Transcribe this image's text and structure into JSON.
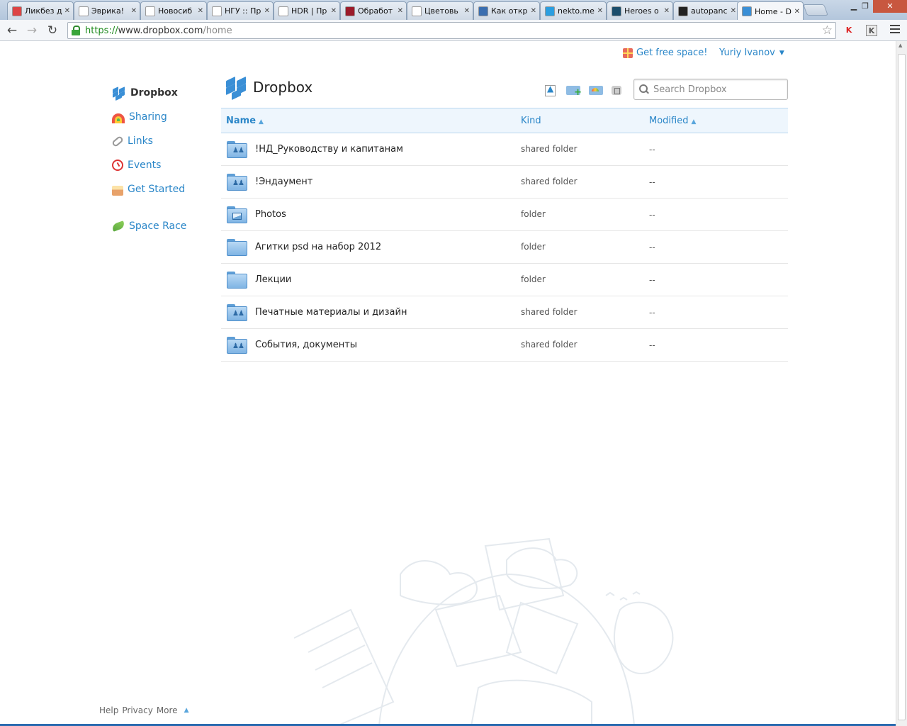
{
  "browser": {
    "tabs": [
      {
        "label": "Ликбез д",
        "icon": "gmail-icon",
        "color": "#d44"
      },
      {
        "label": "Эврика!",
        "icon": "page-icon",
        "color": "#fff"
      },
      {
        "label": "Новосиб",
        "icon": "page-icon",
        "color": "#fff"
      },
      {
        "label": "НГУ :: Пр",
        "icon": "page-icon",
        "color": "#fff"
      },
      {
        "label": "HDR | Пр",
        "icon": "search-icon",
        "color": "#fff"
      },
      {
        "label": "Обработ",
        "icon": "camera-icon",
        "color": "#9b1b2a"
      },
      {
        "label": "Цветовь",
        "icon": "search-icon",
        "color": "#fff"
      },
      {
        "label": "Как откр",
        "icon": "tpp-icon",
        "color": "#3a6eb0"
      },
      {
        "label": "nekto.me",
        "icon": "me-icon",
        "color": "#2a9ee0"
      },
      {
        "label": "Heroes o",
        "icon": "heroes-icon",
        "color": "#1b4d6b"
      },
      {
        "label": "autopanc",
        "icon": "li-icon",
        "color": "#222"
      },
      {
        "label": "Home - D",
        "icon": "dropbox-icon",
        "color": "#3a8fd6"
      }
    ],
    "url_scheme": "https://",
    "url_host": "www.dropbox.com",
    "url_path": "/home"
  },
  "topbar": {
    "free_space": "Get free space!",
    "user": "Yuriy Ivanov"
  },
  "sidebar": {
    "items": [
      {
        "label": "Dropbox"
      },
      {
        "label": "Sharing"
      },
      {
        "label": "Links"
      },
      {
        "label": "Events"
      },
      {
        "label": "Get Started"
      },
      {
        "label": "Space Race"
      }
    ]
  },
  "main": {
    "title": "Dropbox",
    "search_placeholder": "Search Dropbox",
    "columns": {
      "name": "Name",
      "kind": "Kind",
      "modified": "Modified"
    },
    "files": [
      {
        "name": "!НД_Руководству и капитанам",
        "kind": "shared folder",
        "modified": "--",
        "type": "shared"
      },
      {
        "name": "!Эндаумент",
        "kind": "shared folder",
        "modified": "--",
        "type": "shared"
      },
      {
        "name": "Photos",
        "kind": "folder",
        "modified": "--",
        "type": "photos"
      },
      {
        "name": "Агитки psd на набор 2012",
        "kind": "folder",
        "modified": "--",
        "type": "plain"
      },
      {
        "name": "Лекции",
        "kind": "folder",
        "modified": "--",
        "type": "plain"
      },
      {
        "name": "Печатные материалы и дизайн",
        "kind": "shared folder",
        "modified": "--",
        "type": "shared"
      },
      {
        "name": "События, документы",
        "kind": "shared folder",
        "modified": "--",
        "type": "shared"
      }
    ]
  },
  "footer": {
    "help": "Help",
    "privacy": "Privacy",
    "more": "More"
  },
  "colors": {
    "link": "#2a86c8",
    "header_bg": "#eef6fd",
    "brand": "#3a8fd6"
  }
}
